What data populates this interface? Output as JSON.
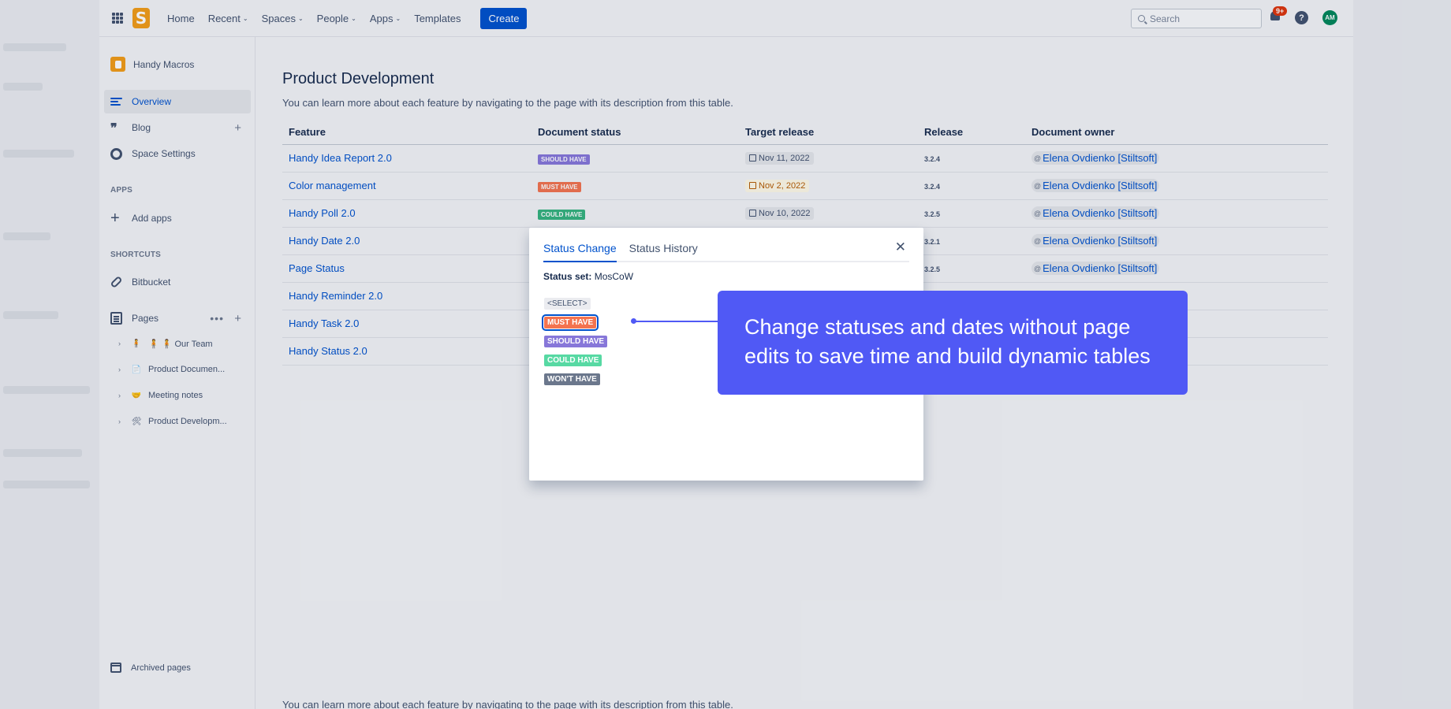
{
  "topnav": {
    "logo_letter": "S",
    "items": [
      {
        "label": "Home",
        "dropdown": false
      },
      {
        "label": "Recent",
        "dropdown": true
      },
      {
        "label": "Spaces",
        "dropdown": true
      },
      {
        "label": "People",
        "dropdown": true
      },
      {
        "label": "Apps",
        "dropdown": true
      },
      {
        "label": "Templates",
        "dropdown": false
      }
    ],
    "create_label": "Create",
    "search_placeholder": "Search",
    "notification_count": "9+",
    "help_label": "?",
    "avatar_initials": "AM"
  },
  "sidebar": {
    "space_name": "Handy Macros",
    "overview_label": "Overview",
    "blog_label": "Blog",
    "settings_label": "Space Settings",
    "apps_heading": "APPS",
    "add_apps_label": "Add apps",
    "shortcuts_heading": "SHORTCUTS",
    "bitbucket_label": "Bitbucket",
    "pages_label": "Pages",
    "tree": [
      {
        "icon": "🧍",
        "label": "🧍 🧍 Our Team"
      },
      {
        "icon": "📄",
        "label": "Product Documen..."
      },
      {
        "icon": "🤝",
        "label": "Meeting notes"
      },
      {
        "icon": "🛠",
        "label": "Product Developm..."
      }
    ],
    "archived_label": "Archived pages"
  },
  "main": {
    "title": "Product Development",
    "intro": "You can learn more about each feature by navigating to the page with its description from this table.",
    "table": {
      "headers": [
        "Feature",
        "Document status",
        "Target release",
        "Release",
        "Document owner"
      ],
      "rows": [
        {
          "feature": "Handy Idea Report 2.0",
          "status": "SHOULD HAVE",
          "status_color": "#8777d9",
          "date": "Nov 11, 2022",
          "date_warn": false,
          "release": "3.2.4",
          "owner": "Elena Ovdienko [Stiltsoft]"
        },
        {
          "feature": "Color management",
          "status": "MUST HAVE",
          "status_color": "#f4734f",
          "date": "Nov 2, 2022",
          "date_warn": true,
          "release": "3.2.4",
          "owner": "Elena Ovdienko [Stiltsoft]"
        },
        {
          "feature": "Handy Poll 2.0",
          "status": "COULD HAVE",
          "status_color": "#36b37e",
          "date": "Nov 10, 2022",
          "date_warn": false,
          "release": "3.2.5",
          "owner": "Elena Ovdienko [Stiltsoft]"
        },
        {
          "feature": "Handy Date 2.0",
          "status": "",
          "status_color": "",
          "date": "",
          "date_warn": false,
          "release": "3.2.1",
          "owner": "Elena Ovdienko [Stiltsoft]"
        },
        {
          "feature": "Page Status",
          "status": "",
          "status_color": "",
          "date": "",
          "date_warn": false,
          "release": "3.2.5",
          "owner": "Elena Ovdienko [Stiltsoft]"
        },
        {
          "feature": "Handy Reminder 2.0",
          "status": "",
          "status_color": "",
          "date": "",
          "date_warn": false,
          "release": "",
          "owner": ""
        },
        {
          "feature": "Handy Task 2.0",
          "status": "",
          "status_color": "",
          "date": "",
          "date_warn": false,
          "release": "",
          "owner": ""
        },
        {
          "feature": "Handy Status 2.0",
          "status": "",
          "status_color": "",
          "date": "",
          "date_warn": false,
          "release": "",
          "owner": ""
        }
      ]
    }
  },
  "dialog": {
    "tabs": [
      "Status Change",
      "Status History"
    ],
    "active_tab": "Status Change",
    "close_label": "✕",
    "status_set_label": "Status set:",
    "status_set_value": "MosCoW",
    "options": [
      {
        "label": "<SELECT>",
        "color": "#ebecf0",
        "selected": false
      },
      {
        "label": "MUST HAVE",
        "color": "#f4734f",
        "selected": true
      },
      {
        "label": "SHOULD HAVE",
        "color": "#8777d9",
        "selected": false
      },
      {
        "label": "COULD HAVE",
        "color": "#57d9a3",
        "selected": false
      },
      {
        "label": "WON'T HAVE",
        "color": "#6b778c",
        "selected": false
      }
    ]
  },
  "callout": {
    "text": "Change statuses and dates without page edits to save time and build dynamic tables",
    "color": "#5059f5"
  }
}
